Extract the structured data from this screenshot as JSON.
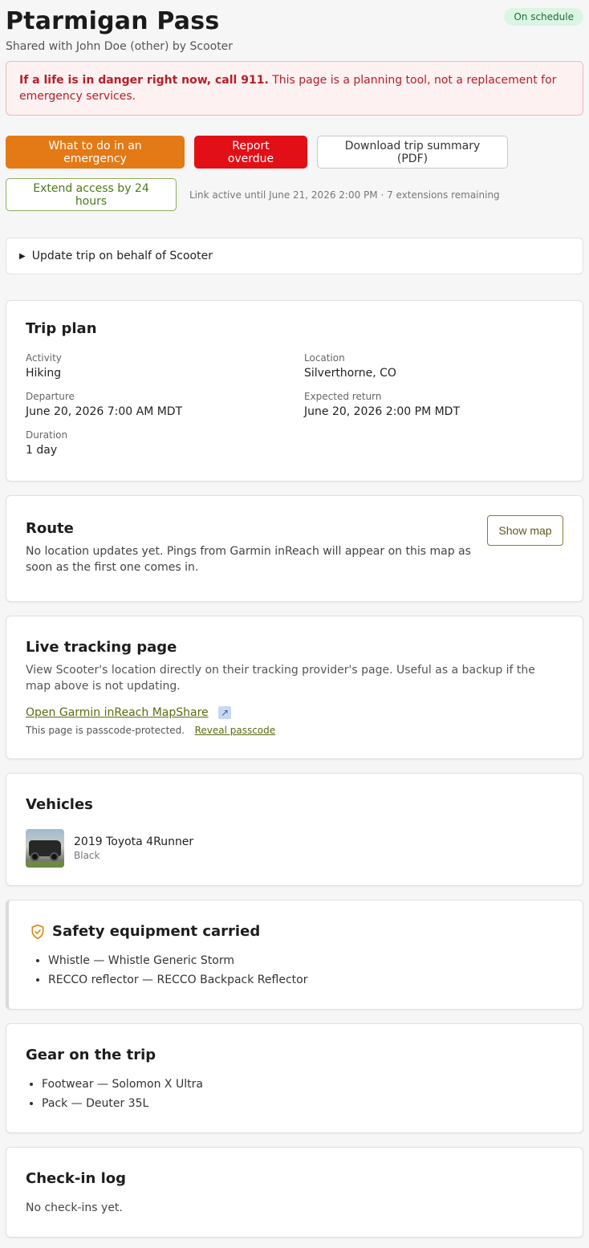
{
  "trip": {
    "title": "Ptarmigan Pass",
    "status": "On schedule",
    "subtitle": "Shared with John Doe (other) by Scooter"
  },
  "alert": {
    "bold": "If a life is in danger right now, call 911.",
    "text": " This page is a planning tool, not a replacement for emergency services."
  },
  "actions": {
    "emergency_label": "What to do in an emergency",
    "overdue_label": "Report overdue",
    "download_label": "Download trip summary (PDF)",
    "extend_label": "Extend access by 24 hours",
    "link_status": "Link active until June 21, 2026 2:00 PM · 7 extensions remaining"
  },
  "update_details": {
    "label": "Update trip on behalf of Scooter"
  },
  "trip_plan": {
    "heading": "Trip plan",
    "fields": [
      {
        "label": "Activity",
        "value": "Hiking"
      },
      {
        "label": "Location",
        "value": "Silverthorne, CO"
      },
      {
        "label": "Departure",
        "value": "June 20, 2026 7:00 AM MDT"
      },
      {
        "label": "Expected return",
        "value": "June 20, 2026 2:00 PM MDT"
      },
      {
        "label": "Duration",
        "value": "1 day"
      }
    ]
  },
  "route": {
    "heading": "Route",
    "text": "No location updates yet. Pings from Garmin inReach will appear on this map as soon as the first one comes in.",
    "show_map_label": "Show map"
  },
  "live_tracking": {
    "heading": "Live tracking page",
    "text": "View Scooter's location directly on their tracking provider's page. Useful as a backup if the map above is not updating.",
    "link_label": "Open Garmin inReach MapShare",
    "passcode_note": "This page is passcode-protected.",
    "reveal_label": "Reveal passcode"
  },
  "vehicles": {
    "heading": "Vehicles",
    "items": [
      {
        "name": "2019 Toyota 4Runner",
        "color": "Black"
      }
    ]
  },
  "safety": {
    "heading": "Safety equipment carried",
    "items": [
      "Whistle — Whistle Generic Storm",
      "RECCO reflector — RECCO Backpack Reflector"
    ]
  },
  "gear": {
    "heading": "Gear on the trip",
    "items": [
      "Footwear — Solomon X Ultra",
      "Pack — Deuter 35L"
    ]
  },
  "checkin": {
    "heading": "Check-in log",
    "empty_text": "No check-ins yet."
  },
  "colors": {
    "emergency": "#e37a16",
    "overdue": "#e30f16",
    "status_bg": "#dcf5e3",
    "alert_text": "#b5202a",
    "accent_link": "#5a6b10"
  },
  "icons": [
    "disclosure-triangle-icon",
    "external-link-icon",
    "shield-check-icon"
  ]
}
